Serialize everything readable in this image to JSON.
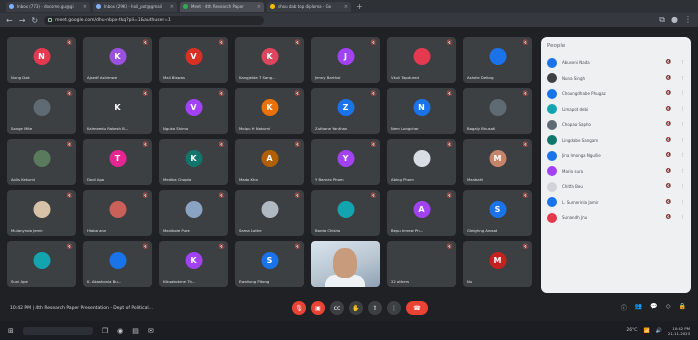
{
  "browser": {
    "tabs": [
      {
        "title": "Inbox (773) - docsme.gu@gi",
        "active": false
      },
      {
        "title": "Inbox (29K) - hoil_pot@gmail",
        "active": false
      },
      {
        "title": "Meet - 4th Research Paper",
        "active": true
      },
      {
        "title": "shou dab top diploma - Go",
        "active": false
      }
    ],
    "url": "meet.google.com/dhu-nbpx-tkq?pli=1&authuser=1"
  },
  "participants": [
    {
      "initial": "N",
      "name": "Nung Dak",
      "color": "#e53950",
      "kind": "avatar"
    },
    {
      "initial": "K",
      "name": "Ajsedf Ashimwe",
      "color": "#9b51e0",
      "kind": "avatar"
    },
    {
      "initial": "V",
      "name": "Mali Biswas",
      "color": "#d93025",
      "kind": "avatar"
    },
    {
      "initial": "K",
      "name": "Kangjelda T Sang...",
      "color": "#e0455e",
      "kind": "avatar"
    },
    {
      "initial": "J",
      "name": "Jenny Barthol",
      "color": "#a142f4",
      "kind": "avatar"
    },
    {
      "initial": "",
      "name": "Vkuli Tapdured",
      "color": "#e53950",
      "kind": "avatar"
    },
    {
      "initial": "",
      "name": "Ashele Delbrg",
      "color": "#1a73e8",
      "kind": "avatar"
    },
    {
      "initial": "",
      "name": "Sange Mite",
      "color": "#5f6b73",
      "kind": "photo"
    },
    {
      "initial": "K",
      "name": "Kalmeedu Rakesh B...",
      "color": "#3c4043",
      "kind": "avatar"
    },
    {
      "initial": "V",
      "name": "Nguko Shimo",
      "color": "#a142f4",
      "kind": "avatar"
    },
    {
      "initial": "K",
      "name": "Molpu H Nakumi",
      "color": "#e8710a",
      "kind": "avatar"
    },
    {
      "initial": "Z",
      "name": "Zuthane Yanthan",
      "color": "#1a73e8",
      "kind": "avatar"
    },
    {
      "initial": "N",
      "name": "Nem Longchar",
      "color": "#1a73e8",
      "kind": "avatar"
    },
    {
      "initial": "",
      "name": "Bagaly Bhusati",
      "color": "#5f6b73",
      "kind": "photo"
    },
    {
      "initial": "",
      "name": "Aolis Kekumi",
      "color": "#5a7a5e",
      "kind": "photo"
    },
    {
      "initial": "T",
      "name": "Dodi Apo",
      "color": "#e52592",
      "kind": "avatar"
    },
    {
      "initial": "K",
      "name": "Medika Chopta",
      "color": "#12756b",
      "kind": "avatar"
    },
    {
      "initial": "A",
      "name": "Mado Kho",
      "color": "#b06000",
      "kind": "avatar"
    },
    {
      "initial": "Y",
      "name": "Y Barnez Phom",
      "color": "#a142f4",
      "kind": "avatar"
    },
    {
      "initial": "",
      "name": "Abing Phom",
      "color": "#d8dde3",
      "kind": "photo"
    },
    {
      "initial": "M",
      "name": "Manbahl",
      "color": "#c5856a",
      "kind": "avatar"
    },
    {
      "initial": "",
      "name": "Mulanyrola Jemir",
      "color": "#d6c2a6",
      "kind": "photo"
    },
    {
      "initial": "",
      "name": "Hlaba ann",
      "color": "#c9615a",
      "kind": "photo"
    },
    {
      "initial": "",
      "name": "Manibole Pure",
      "color": "#8aa3c2",
      "kind": "photo"
    },
    {
      "initial": "",
      "name": "Sama Lothe",
      "color": "#b0b8c2",
      "kind": "photo"
    },
    {
      "initial": "",
      "name": "Barda Chisho",
      "color": "#12a4af",
      "kind": "avatar"
    },
    {
      "initial": "A",
      "name": "Bepu Imrew Ph...",
      "color": "#a142f4",
      "kind": "avatar"
    },
    {
      "initial": "S",
      "name": "Gleighng Arosat",
      "color": "#1a73e8",
      "kind": "avatar"
    },
    {
      "initial": "",
      "name": "Suni Ape",
      "color": "#12a4af",
      "kind": "avatar"
    },
    {
      "initial": "",
      "name": "K. Akashonla Bu...",
      "color": "#1a73e8",
      "kind": "photo"
    },
    {
      "initial": "K",
      "name": "Kikuakokme Th...",
      "color": "#a142f4",
      "kind": "avatar"
    },
    {
      "initial": "S",
      "name": "Ewaliung Pitong",
      "color": "#1a73e8",
      "kind": "avatar"
    },
    {
      "initial": "",
      "name": "",
      "color": "",
      "kind": "video"
    },
    {
      "initial": "",
      "name": "22 others",
      "color": "#3c4043",
      "kind": "others"
    },
    {
      "initial": "M",
      "name": "Nu",
      "color": "#c5221f",
      "kind": "avatar"
    }
  ],
  "people_panel": {
    "title": "People",
    "rows": [
      {
        "name": "Abuseni Nada",
        "color": "#1a73e8"
      },
      {
        "name": "Nuna Singh",
        "color": "#3c4043"
      },
      {
        "name": "Choungdhabe Phugaz",
        "color": "#1a73e8"
      },
      {
        "name": "Limapot debi",
        "color": "#12a4af"
      },
      {
        "name": "Chopaa Sapho",
        "color": "#5f6b73"
      },
      {
        "name": "Lingdabe Sangam",
        "color": "#12756b"
      },
      {
        "name": "Jina Imonga Ngullie",
        "color": "#1a73e8"
      },
      {
        "name": "Mario sura",
        "color": "#a142f4"
      },
      {
        "name": "Chitfa Beu",
        "color": "#d0d3d8"
      },
      {
        "name": "L. Sumerinla Jamir",
        "color": "#1a73e8"
      },
      {
        "name": "Sunandh Jnu",
        "color": "#e53950"
      }
    ]
  },
  "bottom": {
    "time": "10:42 PM",
    "separator": "|",
    "meeting_title": "4th Research Paper Presentation - Dept of Political..."
  },
  "taskbar": {
    "weather": "26°C",
    "clock_time": "10:42 PM",
    "clock_date": "21-11-2023"
  }
}
